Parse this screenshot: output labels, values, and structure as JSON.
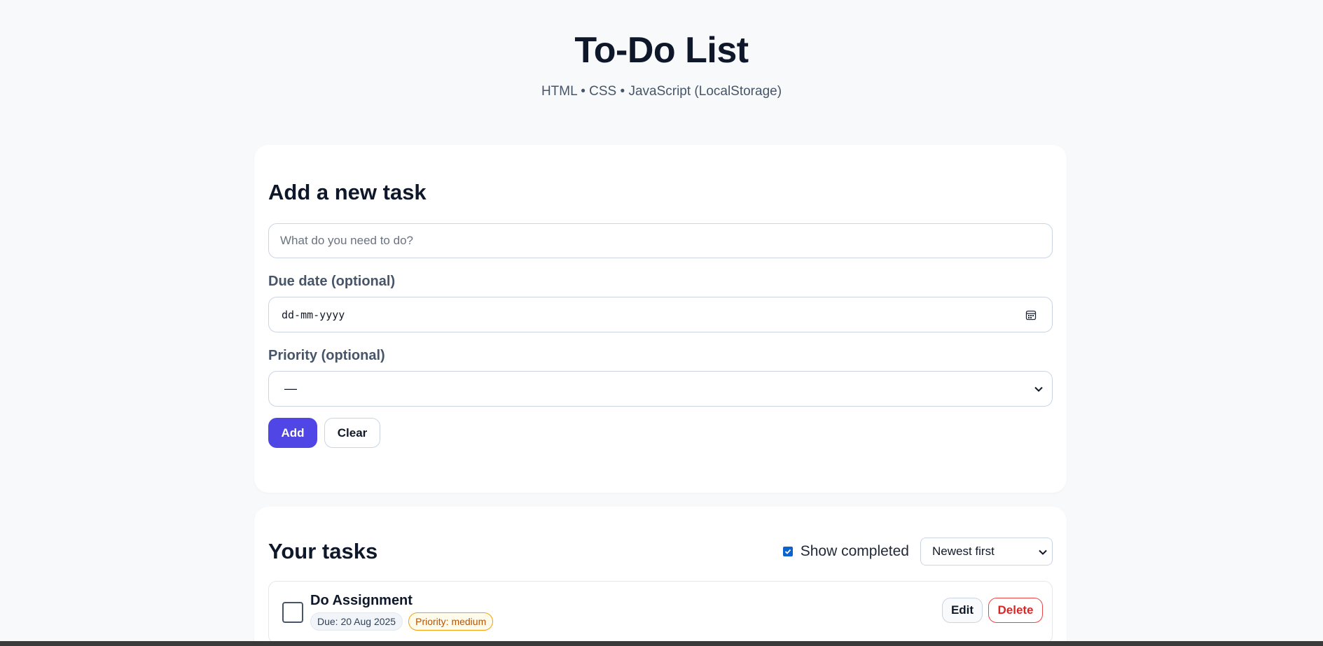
{
  "header": {
    "title": "To-Do List",
    "subtitle": "HTML • CSS • JavaScript (LocalStorage)"
  },
  "add_form": {
    "heading": "Add a new task",
    "task_placeholder": "What do you need to do?",
    "due_label": "Due date (optional)",
    "due_value": "dd-mm-yyyy",
    "priority_label": "Priority (optional)",
    "priority_value": "—",
    "add_label": "Add",
    "clear_label": "Clear"
  },
  "tasks_panel": {
    "heading": "Your tasks",
    "show_completed_label": "Show completed",
    "show_completed_checked": true,
    "sort_value": "Newest first",
    "tasks": [
      {
        "title": "Do Assignment",
        "due": "Due: 20 Aug 2025",
        "priority": "Priority: medium",
        "completed": false,
        "edit_label": "Edit",
        "delete_label": "Delete"
      }
    ]
  },
  "colors": {
    "accent": "#4f46e5",
    "danger": "#dc2626",
    "priority_medium": "#b45309",
    "checkbox": "#0b63ce"
  }
}
